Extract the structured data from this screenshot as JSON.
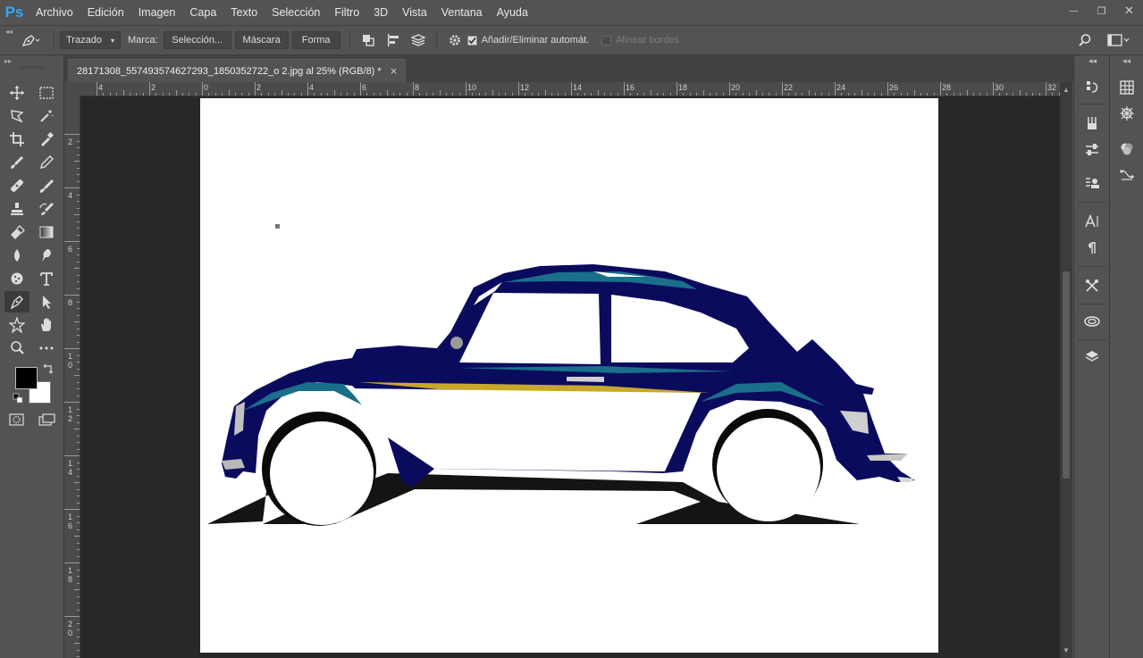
{
  "menubar": {
    "logo": "Ps",
    "items": [
      "Archivo",
      "Edición",
      "Imagen",
      "Capa",
      "Texto",
      "Selección",
      "Filtro",
      "3D",
      "Vista",
      "Ventana",
      "Ayuda"
    ]
  },
  "window_controls": {
    "minimize": "—",
    "restore": "❐",
    "close": "✕"
  },
  "options_bar": {
    "mode_select": "Trazado",
    "marca_label": "Marca:",
    "seleccion_button": "Selección...",
    "mascara_button": "Máscara",
    "forma_button": "Forma",
    "auto_add_delete_label": "Añadir/Eliminar automát.",
    "auto_add_delete_checked": true,
    "align_edges_label": "Alinear bordes",
    "align_edges_checked": false
  },
  "document_tab": {
    "title": "28171308_557493574627293_1850352722_o 2.jpg al 25% (RGB/8) *",
    "close": "×"
  },
  "ruler_top_labels": [
    "4",
    "2",
    "0",
    "2",
    "4",
    "6",
    "8",
    "10",
    "12",
    "14",
    "16",
    "18",
    "20",
    "22",
    "24",
    "26",
    "28",
    "30",
    "32"
  ],
  "ruler_left_labels": [
    "2",
    "4",
    "6",
    "8",
    "10",
    "12",
    "14",
    "16",
    "18",
    "20"
  ],
  "colors": {
    "foreground": "#000000",
    "background": "#ffffff",
    "car_body": "#0b0b5e",
    "car_highlight": "#1a6f8a",
    "car_stripe": "#c8a82a",
    "accent": "#31a8ff"
  },
  "tools": [
    "move-tool",
    "marquee-tool",
    "lasso-tool",
    "magic-wand-tool",
    "crop-tool",
    "eyedropper-tool",
    "brush-tool",
    "pencil-tool",
    "healing-tool",
    "smudge-brush-tool",
    "clone-stamp-tool",
    "history-brush-tool",
    "eraser-tool",
    "gradient-tool",
    "blur-tool",
    "dodge-tool",
    "sponge-tool",
    "type-tool",
    "pen-tool",
    "path-selection-tool",
    "custom-shape-tool",
    "hand-tool",
    "zoom-tool",
    "more-tools"
  ]
}
